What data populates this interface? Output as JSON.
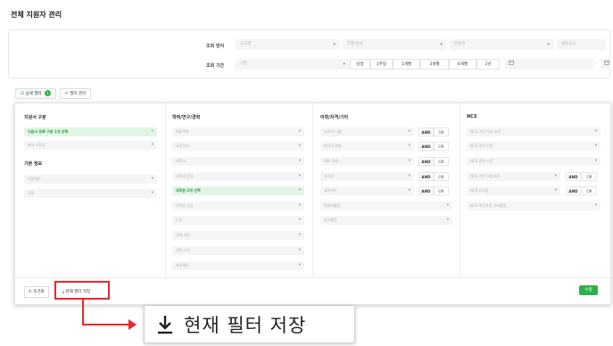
{
  "page": {
    "title": "전체 지원자 관리"
  },
  "search": {
    "method_label": "조회 방식",
    "period_label": "조회 기간",
    "method_selects": [
      {
        "placeholder": "공고명"
      },
      {
        "placeholder": "진행 분류"
      },
      {
        "placeholder": "전형명"
      }
    ],
    "method_input_placeholder": "채용공고",
    "period_select": "구분",
    "period_buttons": [
      "당일",
      "1주일",
      "1개월",
      "3개월",
      "6개월",
      "1년"
    ],
    "date_separator": "-"
  },
  "tabs": {
    "detail_filter": "상세 필터",
    "detail_badge": "1",
    "filter_manage": "필터 관리"
  },
  "filter_columns": {
    "col1": {
      "heading": "지원서 구분",
      "items": [
        {
          "text": "지원서 등록 구분 1개 선택",
          "selected": true
        },
        {
          "text": "최저 지원자",
          "selected": false
        }
      ],
      "sub_heading": "기본 정보",
      "sub_items": [
        {
          "text": "지원경로"
        },
        {
          "text": "국적"
        }
      ]
    },
    "col2": {
      "heading": "학력/연구/경력",
      "items": [
        {
          "text": "최종학력",
          "selected": false
        },
        {
          "text": "고등학교",
          "selected": false
        },
        {
          "text": "대학교",
          "selected": false
        },
        {
          "text": "대학교 전공",
          "selected": false
        },
        {
          "text": "대학원 2개 선택",
          "selected": true
        },
        {
          "text": "대학원 전공",
          "selected": false
        },
        {
          "text": "논문",
          "selected": false
        },
        {
          "text": "경력 기준",
          "selected": false
        },
        {
          "text": "경력 기간",
          "selected": false
        },
        {
          "text": "프로젝트",
          "selected": false
        }
      ]
    },
    "col3": {
      "heading": "어학/자격/기타",
      "items": [
        {
          "text": "외국어 시험"
        },
        {
          "text": "외국어 회화"
        },
        {
          "text": "해외 경험"
        },
        {
          "text": "자격증"
        },
        {
          "text": "교육이수"
        },
        {
          "text": "학내외활동"
        },
        {
          "text": "봉사활동"
        }
      ],
      "and_or_rows": 5
    },
    "col4": {
      "heading": "NCS",
      "items": [
        {
          "text": "NCS 기반 학교 교육"
        },
        {
          "text": "NCS 경력 기준"
        },
        {
          "text": "NCS 경력 기간"
        },
        {
          "text": "NCS 기반 직업교육"
        },
        {
          "text": "NCS 자격증"
        },
        {
          "text": "NCS 직무관련 기타활동"
        }
      ]
    }
  },
  "logic": {
    "and": "AND",
    "or": "OR"
  },
  "footer": {
    "reset": "초기화",
    "save_filter": "현재 필터 저장",
    "apply": "수정"
  },
  "callout": {
    "text": "현재 필터 저장"
  },
  "colors": {
    "accent_green": "#2db24a",
    "annotation_red": "#e8282b"
  }
}
